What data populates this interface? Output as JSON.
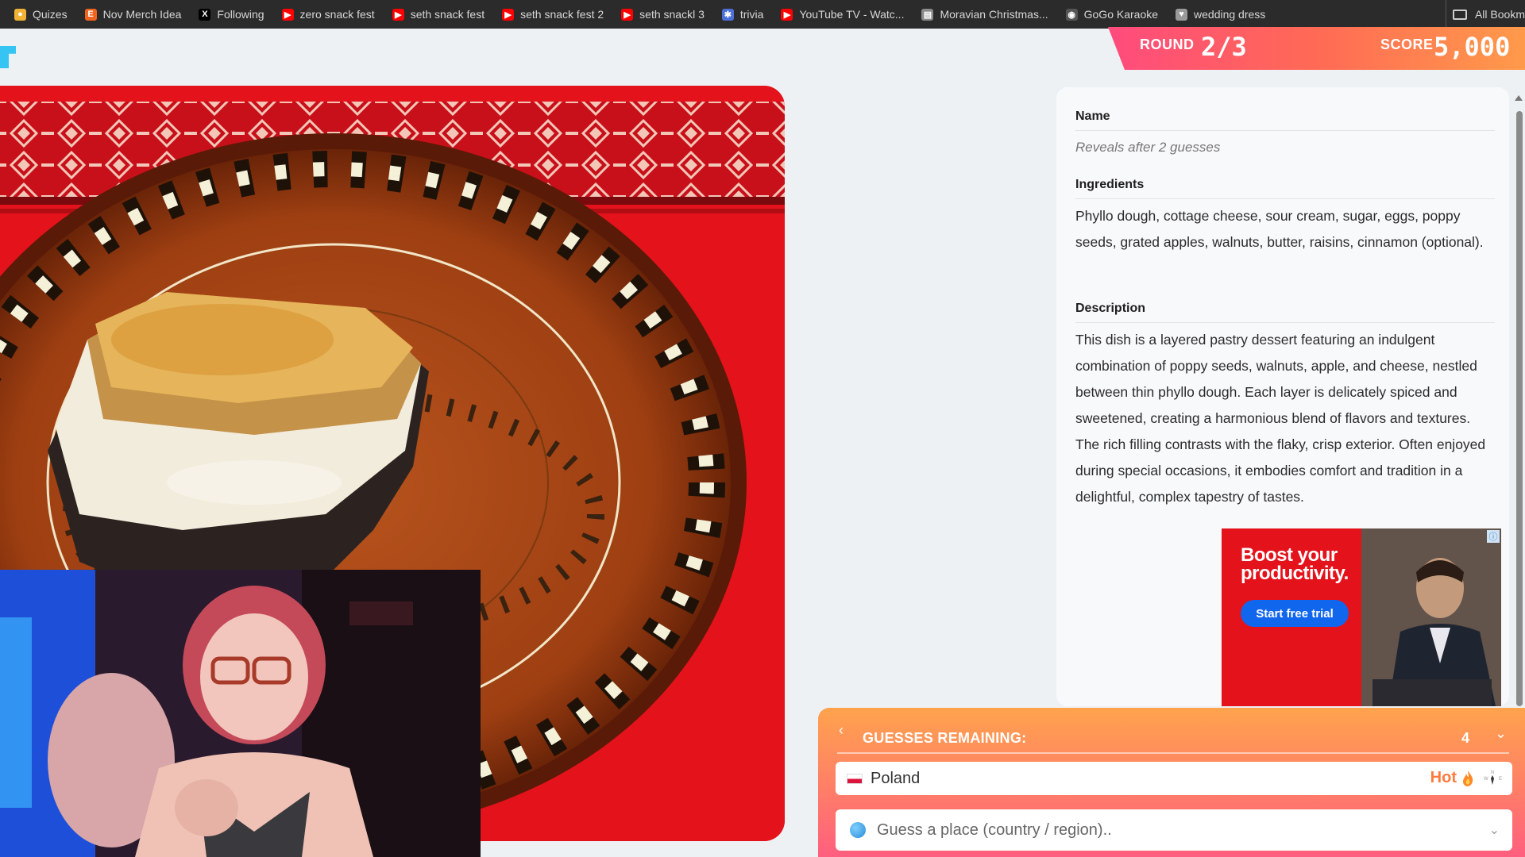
{
  "bookmarks": [
    {
      "label": "Quizes",
      "icon": "bulb-icon",
      "color": "#f2b233"
    },
    {
      "label": "Nov Merch Idea",
      "icon": "etsy-icon",
      "color": "#f1641e"
    },
    {
      "label": "Following",
      "icon": "x-icon",
      "color": "#000000"
    },
    {
      "label": "zero snack fest",
      "icon": "youtube-icon",
      "color": "#ff0000"
    },
    {
      "label": "seth snack fest",
      "icon": "youtube-icon",
      "color": "#ff0000"
    },
    {
      "label": "seth snack fest 2",
      "icon": "youtube-icon",
      "color": "#ff0000"
    },
    {
      "label": "seth snackl 3",
      "icon": "youtube-icon",
      "color": "#ff0000"
    },
    {
      "label": "trivia",
      "icon": "star-icon",
      "color": "#4c6fd8"
    },
    {
      "label": "YouTube TV - Watc...",
      "icon": "youtube-icon",
      "color": "#ff0000"
    },
    {
      "label": "Moravian Christmas...",
      "icon": "page-icon",
      "color": "#8a8a8a"
    },
    {
      "label": "GoGo Karaoke",
      "icon": "mic-icon",
      "color": "#555555"
    },
    {
      "label": "wedding dress",
      "icon": "heart-icon",
      "color": "#9a9a9a"
    }
  ],
  "all_bookmarks": "All Bookm",
  "game": {
    "round_label": "ROUND",
    "round_value": "2/3",
    "score_label": "SCORE",
    "score_value": "5,000"
  },
  "info": {
    "name_heading": "Name",
    "name_value": "Reveals after 2 guesses",
    "ingredients_heading": "Ingredients",
    "ingredients_text": "Phyllo dough, cottage cheese, sour cream, sugar, eggs, poppy seeds, grated apples, walnuts, butter, raisins, cinnamon (optional).",
    "description_heading": "Description",
    "description_text": "This dish is a layered pastry dessert featuring an indulgent combination of poppy seeds, walnuts, apple, and cheese, nestled between thin phyllo dough. Each layer is delicately spiced and sweetened, creating a harmonious blend of flavors and textures. The rich filling contrasts with the flaky, crisp exterior. Often enjoyed during special occasions, it embodies comfort and tradition in a delightful, complex tapestry of tastes."
  },
  "ad": {
    "headline_1": "Boost your",
    "headline_2": "productivity.",
    "cta": "Start free trial",
    "brand_color": "#e4121b"
  },
  "guesses": {
    "title": "GUESSES REMAINING:",
    "remaining": "4",
    "list": [
      {
        "country": "Poland",
        "flag": "poland-flag-icon",
        "temperature": "Hot"
      }
    ],
    "input_placeholder": "Guess a place (country / region).."
  }
}
